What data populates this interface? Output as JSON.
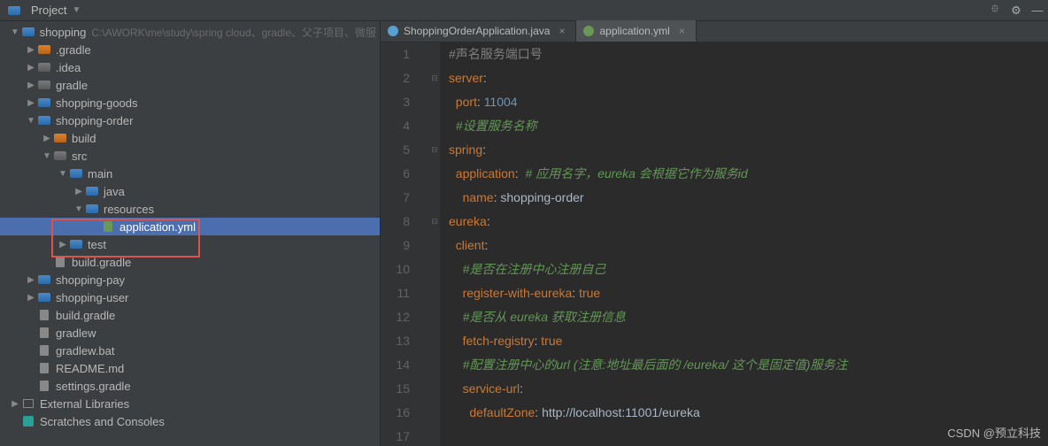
{
  "titlebar": {
    "project_label": "Project"
  },
  "tabs": [
    {
      "label": "ShoppingOrderApplication.java",
      "icon": "java"
    },
    {
      "label": "application.yml",
      "icon": "yml",
      "active": true
    }
  ],
  "tree": [
    {
      "indent": 0,
      "arrow": "open",
      "icon": "folder-blue",
      "label": "shopping",
      "dim": "C:\\AWORK\\me\\study\\spring cloud、gradle、父子项目、微服"
    },
    {
      "indent": 1,
      "arrow": "closed",
      "icon": "folder-orange",
      "label": ".gradle"
    },
    {
      "indent": 1,
      "arrow": "closed",
      "icon": "folder-gray",
      "label": ".idea"
    },
    {
      "indent": 1,
      "arrow": "closed",
      "icon": "folder-gray",
      "label": "gradle"
    },
    {
      "indent": 1,
      "arrow": "closed",
      "icon": "folder-blue",
      "label": "shopping-goods"
    },
    {
      "indent": 1,
      "arrow": "open",
      "icon": "folder-blue",
      "label": "shopping-order"
    },
    {
      "indent": 2,
      "arrow": "closed",
      "icon": "folder-orange",
      "label": "build"
    },
    {
      "indent": 2,
      "arrow": "open",
      "icon": "folder-gray",
      "label": "src"
    },
    {
      "indent": 3,
      "arrow": "open",
      "icon": "folder-blue",
      "label": "main"
    },
    {
      "indent": 4,
      "arrow": "closed",
      "icon": "folder-blue",
      "label": "java"
    },
    {
      "indent": 4,
      "arrow": "open",
      "icon": "folder-blue",
      "label": "resources",
      "boxed": true
    },
    {
      "indent": 5,
      "arrow": "none",
      "icon": "file-green",
      "label": "application.yml",
      "selected": true,
      "boxed": true
    },
    {
      "indent": 3,
      "arrow": "closed",
      "icon": "folder-blue",
      "label": "test"
    },
    {
      "indent": 2,
      "arrow": "none",
      "icon": "file-gray",
      "label": "build.gradle"
    },
    {
      "indent": 1,
      "arrow": "closed",
      "icon": "folder-blue",
      "label": "shopping-pay"
    },
    {
      "indent": 1,
      "arrow": "closed",
      "icon": "folder-blue",
      "label": "shopping-user"
    },
    {
      "indent": 1,
      "arrow": "none",
      "icon": "file-gray",
      "label": "build.gradle"
    },
    {
      "indent": 1,
      "arrow": "none",
      "icon": "file-gray",
      "label": "gradlew"
    },
    {
      "indent": 1,
      "arrow": "none",
      "icon": "file-gray",
      "label": "gradlew.bat"
    },
    {
      "indent": 1,
      "arrow": "none",
      "icon": "file-gray",
      "label": "README.md"
    },
    {
      "indent": 1,
      "arrow": "none",
      "icon": "file-gray",
      "label": "settings.gradle"
    },
    {
      "indent": 0,
      "arrow": "closed",
      "icon": "libs-icon",
      "label": "External Libraries"
    },
    {
      "indent": 0,
      "arrow": "none",
      "icon": "scratches-icon",
      "label": "Scratches and Consoles"
    }
  ],
  "code": {
    "lines": [
      {
        "n": 1,
        "fold": "",
        "tokens": [
          [
            "comment",
            "#声名服务端口号"
          ]
        ]
      },
      {
        "n": 2,
        "fold": "⊟",
        "tokens": [
          [
            "key",
            "server"
          ],
          [
            "plain",
            ":"
          ]
        ]
      },
      {
        "n": 3,
        "fold": "",
        "tokens": [
          [
            "plain",
            "  "
          ],
          [
            "key",
            "port"
          ],
          [
            "plain",
            ": "
          ],
          [
            "num",
            "11004"
          ]
        ]
      },
      {
        "n": 4,
        "fold": "",
        "tokens": [
          [
            "plain",
            "  "
          ],
          [
            "green",
            "#设置服务名称"
          ]
        ]
      },
      {
        "n": 5,
        "fold": "⊟",
        "tokens": [
          [
            "key",
            "spring"
          ],
          [
            "plain",
            ":"
          ]
        ]
      },
      {
        "n": 6,
        "fold": "",
        "tokens": [
          [
            "plain",
            "  "
          ],
          [
            "key",
            "application"
          ],
          [
            "plain",
            ":  "
          ],
          [
            "green",
            "# 应用名字，eureka 会根据它作为服务id"
          ]
        ]
      },
      {
        "n": 7,
        "fold": "",
        "tokens": [
          [
            "plain",
            "    "
          ],
          [
            "key",
            "name"
          ],
          [
            "plain",
            ": "
          ],
          [
            "val",
            "shopping-order"
          ]
        ]
      },
      {
        "n": 8,
        "fold": "⊟",
        "tokens": [
          [
            "key",
            "eureka"
          ],
          [
            "plain",
            ":"
          ]
        ]
      },
      {
        "n": 9,
        "fold": "",
        "tokens": [
          [
            "plain",
            "  "
          ],
          [
            "key",
            "client"
          ],
          [
            "plain",
            ":"
          ]
        ]
      },
      {
        "n": 10,
        "fold": "",
        "tokens": [
          [
            "plain",
            "    "
          ],
          [
            "green",
            "#是否在注册中心注册自己"
          ]
        ]
      },
      {
        "n": 11,
        "fold": "",
        "tokens": [
          [
            "plain",
            "    "
          ],
          [
            "key",
            "register-with-eureka"
          ],
          [
            "plain",
            ": "
          ],
          [
            "kw",
            "true"
          ]
        ]
      },
      {
        "n": 12,
        "fold": "",
        "tokens": [
          [
            "plain",
            "    "
          ],
          [
            "green",
            "#是否从 eureka 获取注册信息"
          ]
        ]
      },
      {
        "n": 13,
        "fold": "",
        "tokens": [
          [
            "plain",
            "    "
          ],
          [
            "key",
            "fetch-registry"
          ],
          [
            "plain",
            ": "
          ],
          [
            "kw",
            "true"
          ]
        ]
      },
      {
        "n": 14,
        "fold": "",
        "tokens": [
          [
            "plain",
            "    "
          ],
          [
            "green",
            "#配置注册中心的url (注意:地址最后面的 /eureka/ 这个是固定值)服务注"
          ]
        ]
      },
      {
        "n": 15,
        "fold": "",
        "tokens": [
          [
            "plain",
            "    "
          ],
          [
            "key",
            "service-url"
          ],
          [
            "plain",
            ":"
          ]
        ]
      },
      {
        "n": 16,
        "fold": "",
        "tokens": [
          [
            "plain",
            "      "
          ],
          [
            "key",
            "defaultZone"
          ],
          [
            "plain",
            ": "
          ],
          [
            "val",
            "http://localhost:11001/eureka"
          ]
        ]
      },
      {
        "n": 17,
        "fold": "",
        "tokens": []
      }
    ]
  },
  "watermark": "CSDN @预立科技"
}
